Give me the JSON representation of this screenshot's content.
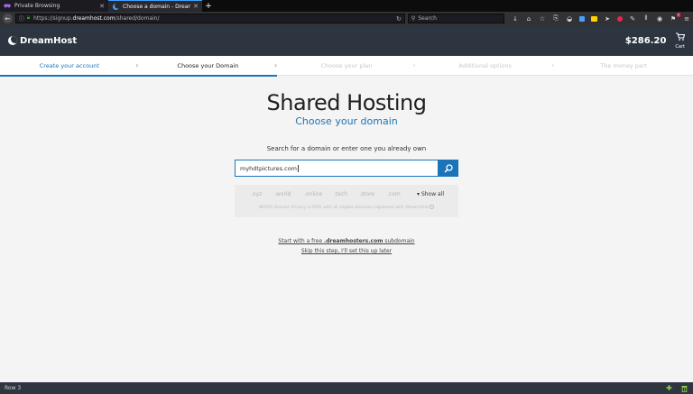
{
  "browser": {
    "tabs": [
      {
        "label": "Private Browsing",
        "icon": "mask-icon"
      },
      {
        "label": "Choose a domain - DreamHos",
        "icon": "dreamhost-favicon"
      }
    ],
    "new_tab_label": "+",
    "url_prefix": "https://signup.",
    "url_domain": "dreamhost.com",
    "url_path": "/shared/domain/",
    "search_placeholder": "Search"
  },
  "header": {
    "brand": "DreamHost",
    "price": "$286.20",
    "cart_label": "Cart"
  },
  "steps": [
    {
      "label": "Create your account",
      "state": "done"
    },
    {
      "label": "Choose your Domain",
      "state": "current"
    },
    {
      "label": "Choose your plan",
      "state": "todo"
    },
    {
      "label": "Additional options",
      "state": "todo"
    },
    {
      "label": "The money part",
      "state": "todo"
    }
  ],
  "main": {
    "title": "Shared Hosting",
    "subtitle": "Choose your domain",
    "prompt": "Search for a domain or enter one you already own",
    "input_value": "myhdtpictures.com",
    "tlds": [
      ".xyz",
      ".world",
      ".online",
      ".tech",
      ".store",
      ".com"
    ],
    "show_all": "Show all",
    "privacy_note": "WHOIS Domain Privacy is FREE with all eligible domains registered with DreamHost",
    "free_link_prefix": "Start with a free ",
    "free_link_domain": ".dreamhosters.com",
    "free_link_suffix": " subdomain",
    "skip_link": "Skip this step, I'll set this up later"
  },
  "statusbar": {
    "text": "Row 3"
  },
  "colors": {
    "accent": "#1b74b8",
    "header_bg": "#2d3541",
    "status_green": "#8ed14b"
  }
}
